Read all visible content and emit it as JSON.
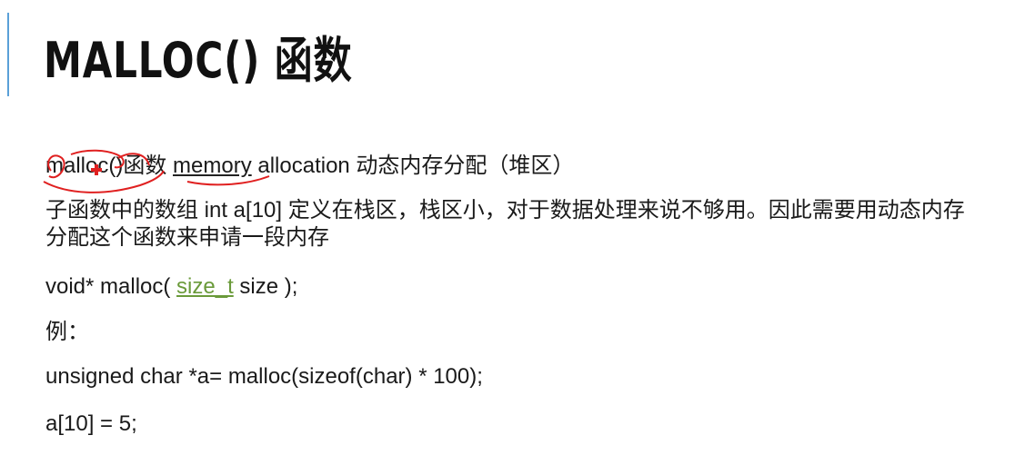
{
  "slide": {
    "title": "MALLOC() 函数",
    "line1": {
      "func": "malloc()",
      "func_suffix": "函数 ",
      "memory": "memory",
      "rest": " allocation 动态内存分配（堆区）"
    },
    "paragraph1": "子函数中的数组 int a[10] 定义在栈区，栈区小，对于数据处理来说不够用。因此需要用动态内存分配这个函数来申请一段内存",
    "prototype": {
      "before": "void* malloc( ",
      "type": "size_t",
      "after": " size );"
    },
    "example_label": "例：",
    "code": [
      "unsigned char *a= malloc(sizeof(char) * 100);",
      "a[10] = 5;"
    ]
  },
  "colors": {
    "accent_bar": "#5aa0d8",
    "annotation_ink": "#e02020",
    "type_link": "#6a9a3a"
  },
  "icons": {
    "cursor": "red-cross-cursor-icon"
  }
}
